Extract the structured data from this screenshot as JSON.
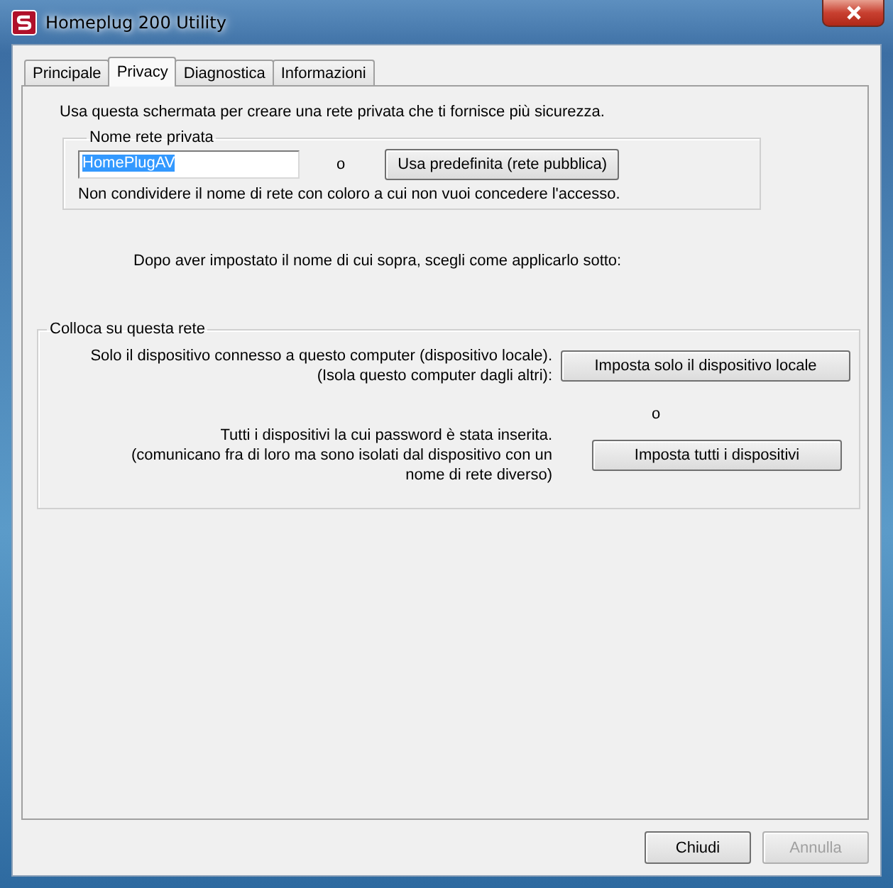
{
  "window": {
    "title": "Homeplug 200 Utility"
  },
  "tabs": [
    {
      "label": "Principale",
      "selected": false
    },
    {
      "label": "Privacy",
      "selected": true
    },
    {
      "label": "Diagnostica",
      "selected": false
    },
    {
      "label": "Informazioni",
      "selected": false
    }
  ],
  "intro": "Usa questa schermata per creare una rete privata che ti fornisce più sicurezza.",
  "private_network": {
    "legend": "Nome rete privata",
    "name_value": "HomePlugAV",
    "name_selected": true,
    "separator": "o",
    "default_button": "Usa predefinita (rete pubblica)",
    "warning": "Non condividere il nome di rete con coloro a cui non vuoi concedere l'accesso."
  },
  "instruction": "Dopo aver impostato il nome di cui sopra, scegli come applicarlo sotto:",
  "apply_group": {
    "legend": "Colloca su questa rete",
    "separator": "o",
    "options": [
      {
        "description": [
          "Solo il dispositivo connesso a questo computer (dispositivo locale).",
          "(Isola questo computer dagli altri):"
        ],
        "button": "Imposta solo il dispositivo locale"
      },
      {
        "description": [
          "Tutti i dispositivi la cui password è stata inserita.",
          "(comunicano fra di loro ma sono isolati dal dispositivo con un",
          "nome di rete diverso)"
        ],
        "button": "Imposta tutti i dispositivi"
      }
    ]
  },
  "buttons": [
    {
      "label": "Chiudi",
      "disabled": false
    },
    {
      "label": "Annulla",
      "disabled": true
    }
  ]
}
